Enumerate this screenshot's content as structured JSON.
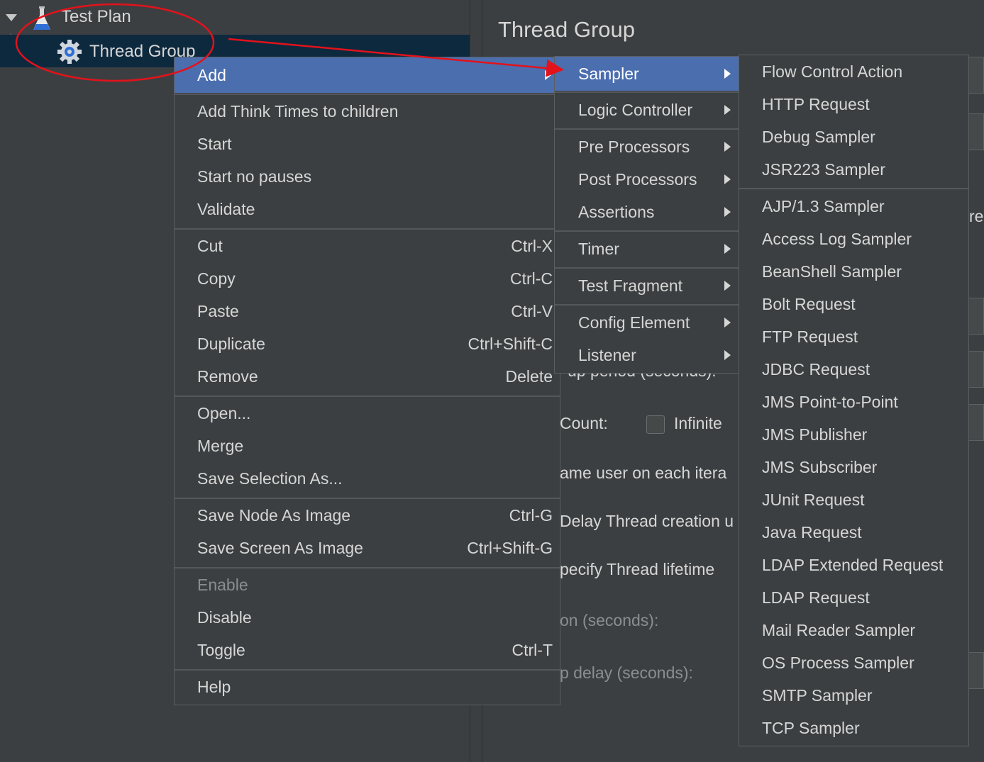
{
  "tree": {
    "test_plan_label": "Test Plan",
    "thread_group_label": "Thread Group"
  },
  "props": {
    "title": "Thread Group",
    "ghost_texts": {
      "rampup": "up period (seconds):",
      "loop_count": "Count:",
      "infinite": "Infinite",
      "same_user": "ame user on each itera",
      "delay_thread": "Delay Thread creation u",
      "specify_lifetime": "pecify Thread lifetime",
      "duration": "on (seconds):",
      "startup_delay": "p delay (seconds):",
      "edge_re": "re"
    }
  },
  "context_menu": {
    "add": "Add",
    "add_think_times": "Add Think Times to children",
    "start": "Start",
    "start_no_pauses": "Start no pauses",
    "validate": "Validate",
    "cut": "Cut",
    "cut_sc": "Ctrl-X",
    "copy": "Copy",
    "copy_sc": "Ctrl-C",
    "paste": "Paste",
    "paste_sc": "Ctrl-V",
    "duplicate": "Duplicate",
    "duplicate_sc": "Ctrl+Shift-C",
    "remove": "Remove",
    "remove_sc": "Delete",
    "open": "Open...",
    "merge": "Merge",
    "save_selection": "Save Selection As...",
    "save_node_image": "Save Node As Image",
    "save_node_image_sc": "Ctrl-G",
    "save_screen_image": "Save Screen As Image",
    "save_screen_image_sc": "Ctrl+Shift-G",
    "enable": "Enable",
    "disable": "Disable",
    "toggle": "Toggle",
    "toggle_sc": "Ctrl-T",
    "help": "Help"
  },
  "add_menu": {
    "sampler": "Sampler",
    "logic_controller": "Logic Controller",
    "pre_processors": "Pre Processors",
    "post_processors": "Post Processors",
    "assertions": "Assertions",
    "timer": "Timer",
    "test_fragment": "Test Fragment",
    "config_element": "Config Element",
    "listener": "Listener"
  },
  "sampler_menu": {
    "items": [
      "Flow Control Action",
      "HTTP Request",
      "Debug Sampler",
      "JSR223 Sampler",
      "AJP/1.3 Sampler",
      "Access Log Sampler",
      "BeanShell Sampler",
      "Bolt Request",
      "FTP Request",
      "JDBC Request",
      "JMS Point-to-Point",
      "JMS Publisher",
      "JMS Subscriber",
      "JUnit Request",
      "Java Request",
      "LDAP Extended Request",
      "LDAP Request",
      "Mail Reader Sampler",
      "OS Process Sampler",
      "SMTP Sampler",
      "TCP Sampler"
    ]
  },
  "colors": {
    "background": "#3c3f41",
    "highlight": "#4b6eaf",
    "selection": "#0d293e",
    "annotation": "#e3121b"
  },
  "icons": {
    "test_plan": "flask-icon",
    "thread_group": "gear-icon",
    "expand": "chevron-down-icon",
    "submenu": "chevron-right-icon"
  }
}
